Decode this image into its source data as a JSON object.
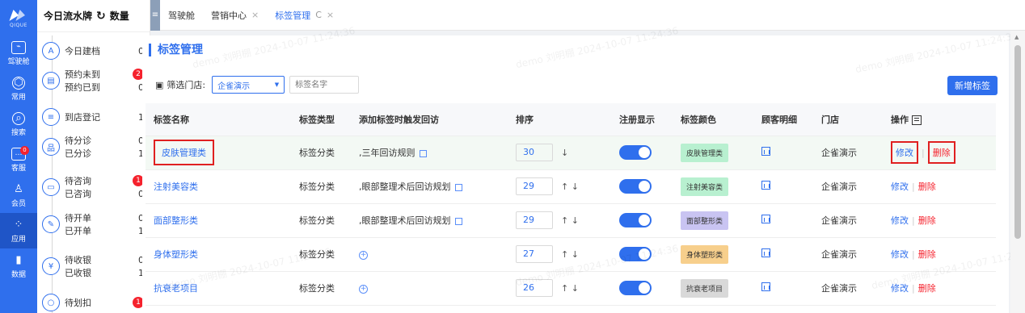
{
  "nav": {
    "items": [
      {
        "label": "驾驶舱",
        "icon": "dashboard-icon",
        "glyph": "⌁"
      },
      {
        "label": "常用",
        "icon": "shield-icon",
        "glyph": "⬡"
      },
      {
        "label": "搜索",
        "icon": "search-icon",
        "glyph": "⌕"
      },
      {
        "label": "客服",
        "icon": "chat-icon",
        "glyph": "…",
        "badge": "0"
      },
      {
        "label": "会员",
        "icon": "members-icon",
        "glyph": "♙"
      },
      {
        "label": "应用",
        "icon": "apps-icon",
        "glyph": "⁘",
        "active": true
      },
      {
        "label": "数据",
        "icon": "data-icon",
        "glyph": "▮"
      }
    ]
  },
  "workbench": {
    "title": "今日流水牌",
    "refresh_icon": "refresh-icon",
    "count_label": "数量",
    "rows": [
      {
        "icon": "person-icon",
        "glyph": "A",
        "lines": [
          {
            "label": "今日建档",
            "value": "0"
          }
        ]
      },
      {
        "icon": "calendar-icon",
        "glyph": "▤",
        "lines": [
          {
            "label": "预约未到",
            "value": "2",
            "badge": true
          },
          {
            "label": "预约已到",
            "value": "0"
          }
        ]
      },
      {
        "icon": "register-icon",
        "glyph": "≡",
        "lines": [
          {
            "label": "到店登记",
            "value": "1"
          }
        ]
      },
      {
        "icon": "triage-icon",
        "glyph": "品",
        "lines": [
          {
            "label": "待分诊",
            "value": "0"
          },
          {
            "label": "已分诊",
            "value": "1"
          }
        ]
      },
      {
        "icon": "consult-icon",
        "glyph": "▭",
        "lines": [
          {
            "label": "待咨询",
            "value": "1",
            "badge": true
          },
          {
            "label": "已咨询",
            "value": "0"
          }
        ]
      },
      {
        "icon": "order-icon",
        "glyph": "✎",
        "lines": [
          {
            "label": "待开单",
            "value": "0"
          },
          {
            "label": "已开单",
            "value": "1"
          }
        ]
      },
      {
        "icon": "cashier-icon",
        "glyph": "¥",
        "lines": [
          {
            "label": "待收银",
            "value": "0"
          },
          {
            "label": "已收银",
            "value": "1"
          }
        ]
      },
      {
        "icon": "deduct-icon",
        "glyph": "○",
        "lines": [
          {
            "label": "待划扣",
            "value": "1",
            "badge": true
          }
        ]
      }
    ]
  },
  "tabs": {
    "menu_icon": "≡",
    "items": [
      {
        "label": "驾驶舱",
        "closable": false
      },
      {
        "label": "营销中心",
        "closable": true
      },
      {
        "label": "标签管理",
        "closable": true,
        "active": true,
        "refresh": "C"
      }
    ],
    "close_glyph": "×"
  },
  "page": {
    "title": "标签管理",
    "filter_label": "筛选门店:",
    "store_select": "企雀演示",
    "tag_name_placeholder": "标签名字",
    "add_button": "新增标签",
    "watermark": "demo 刘明棚 2024-10-07 11:24:36"
  },
  "table": {
    "columns": [
      "标签名称",
      "标签类型",
      "添加标签时触发回访",
      "排序",
      "注册显示",
      "标签颜色",
      "顾客明细",
      "门店",
      "操作"
    ],
    "edit_label": "修改",
    "delete_label": "删除",
    "rows": [
      {
        "name": "皮肤管理类",
        "type": "标签分类",
        "trigger": ",三年回访规则",
        "has_trigger": true,
        "sort": "30",
        "arrows": "↓",
        "color_label": "皮肤管理类",
        "color": "#b8f0d0",
        "store": "企雀演示",
        "highlight": true
      },
      {
        "name": "注射美容类",
        "type": "标签分类",
        "trigger": ",眼部整理术后回访规划",
        "has_trigger": true,
        "sort": "29",
        "arrows": "↑ ↓",
        "color_label": "注射美容类",
        "color": "#b8f0d0",
        "store": "企雀演示"
      },
      {
        "name": "面部整形类",
        "type": "标签分类",
        "trigger": ",眼部整理术后回访规划",
        "has_trigger": true,
        "sort": "29",
        "arrows": "↑ ↓",
        "color_label": "面部整形类",
        "color": "#c9c4f2",
        "store": "企雀演示"
      },
      {
        "name": "身体塑形类",
        "type": "标签分类",
        "trigger": "",
        "has_trigger": false,
        "sort": "27",
        "arrows": "↑ ↓",
        "color_label": "身体塑形类",
        "color": "#f7cf8c",
        "store": "企雀演示"
      },
      {
        "name": "抗衰老项目",
        "type": "标签分类",
        "trigger": "",
        "has_trigger": false,
        "sort": "26",
        "arrows": "↑ ↓",
        "color_label": "抗衰老项目",
        "color": "#d9d9d9",
        "store": "企雀演示"
      }
    ]
  }
}
